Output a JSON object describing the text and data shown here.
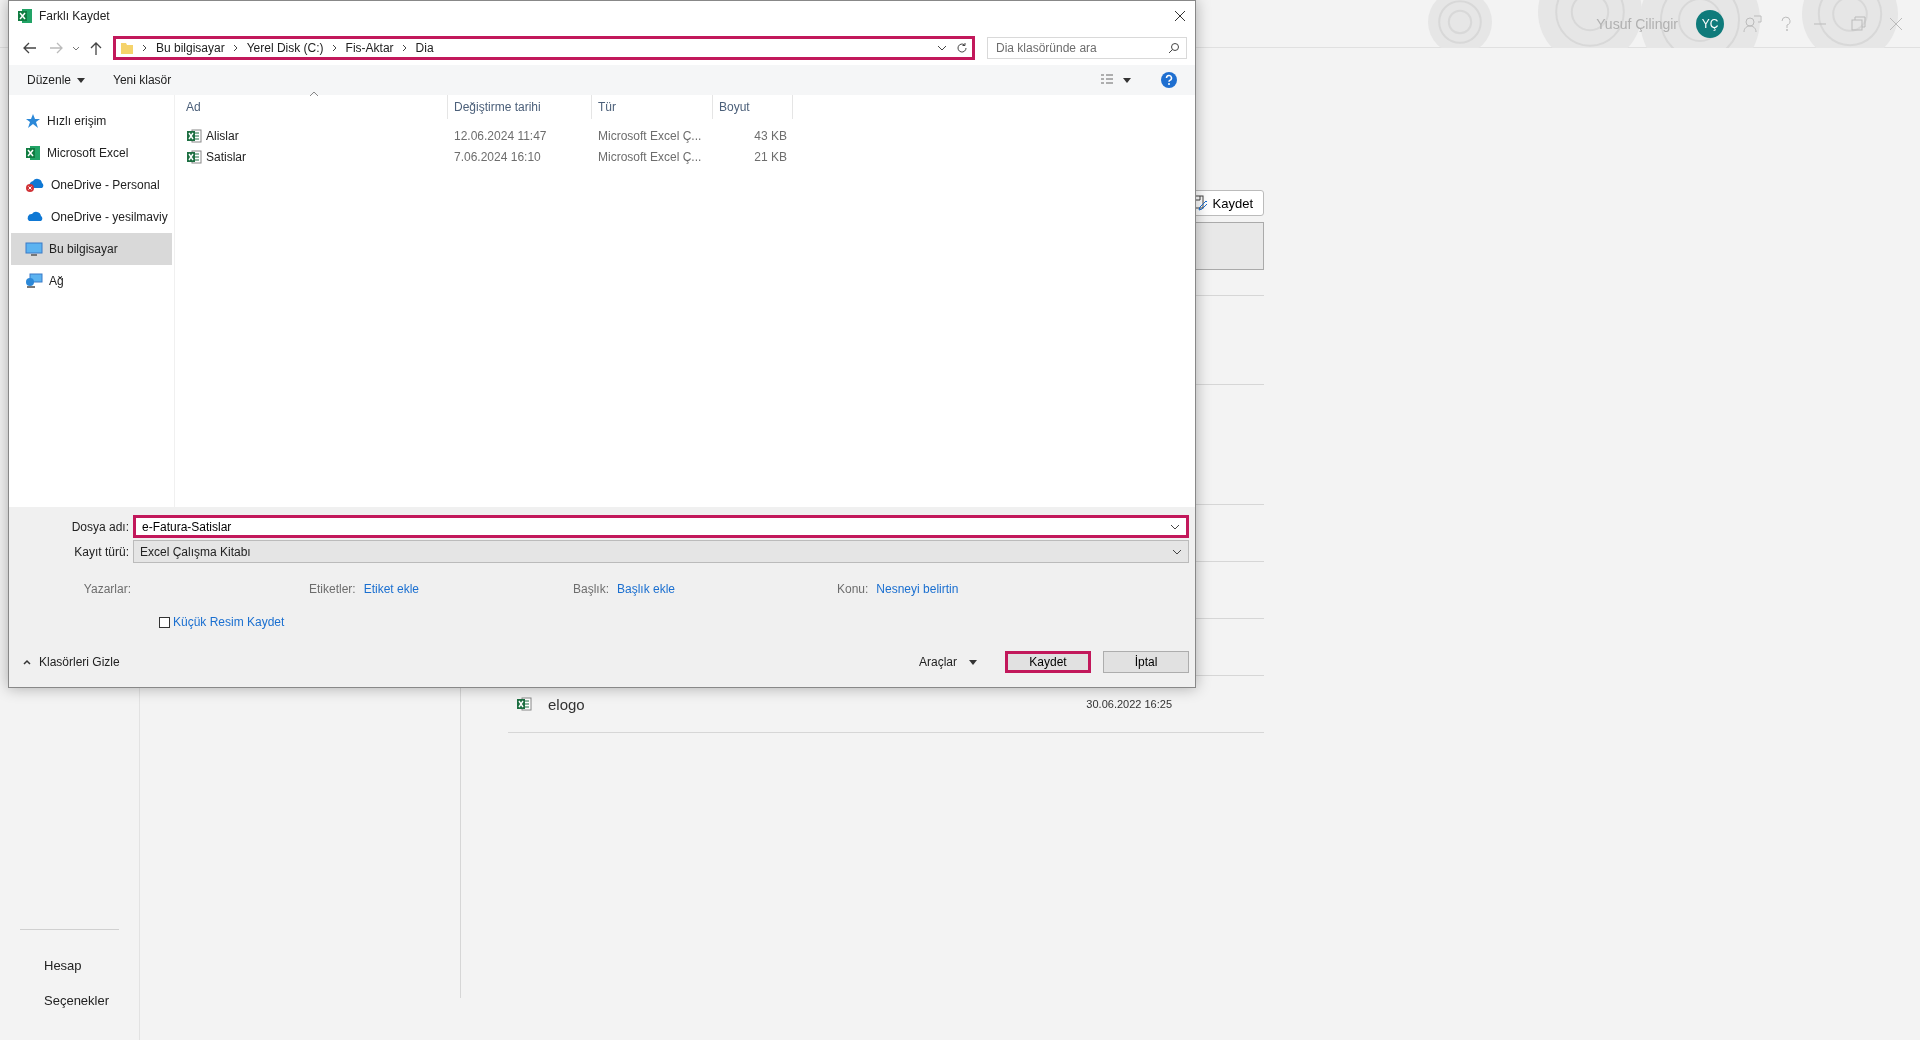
{
  "background": {
    "account_name": "Yusuf Çilingir",
    "avatar_initials": "YÇ",
    "save_button": "Kaydet",
    "files": [
      {
        "name": "elogo",
        "modified": "30.06.2022 16:25"
      }
    ],
    "nav": [
      "Hesap",
      "Seçenekler"
    ]
  },
  "dialog": {
    "title": "Farklı Kaydet",
    "address": {
      "path": [
        "Bu bilgisayar",
        "Yerel Disk (C:)",
        "Fis-Aktar",
        "Dia"
      ],
      "highlighted": true
    },
    "search": {
      "placeholder": "Dia klasöründe ara"
    },
    "toolbar": {
      "organize": "Düzenle",
      "new_folder": "Yeni klasör"
    },
    "sidebar": [
      {
        "label": "Hızlı erişim",
        "kind": "star",
        "selected": false
      },
      {
        "label": "Microsoft Excel",
        "kind": "excel",
        "selected": false
      },
      {
        "label": "OneDrive - Personal",
        "kind": "cloud-error",
        "selected": false
      },
      {
        "label": "OneDrive - yesilmaviy",
        "kind": "cloud",
        "selected": false
      },
      {
        "label": "Bu bilgisayar",
        "kind": "computer",
        "selected": true
      },
      {
        "label": "Ağ",
        "kind": "network",
        "selected": false
      }
    ],
    "columns": [
      {
        "label": "Ad",
        "sorted": true
      },
      {
        "label": "Değiştirme tarihi",
        "sorted": false
      },
      {
        "label": "Tür",
        "sorted": false
      },
      {
        "label": "Boyut",
        "sorted": false
      }
    ],
    "files": [
      {
        "name": "Alislar",
        "modified": "12.06.2024 11:47",
        "type": "Microsoft Excel Ç...",
        "size": "43 KB"
      },
      {
        "name": "Satislar",
        "modified": "7.06.2024 16:10",
        "type": "Microsoft Excel Ç...",
        "size": "21 KB"
      }
    ],
    "file_name": {
      "label": "Dosya adı:",
      "value": "e-Fatura-Satislar",
      "highlighted": true
    },
    "file_type": {
      "label": "Kayıt türü:",
      "value": "Excel Çalışma Kitabı"
    },
    "metadata": [
      {
        "label": "Yazarlar:"
      },
      {
        "label": "Etiketler:",
        "value": "Etiket ekle"
      },
      {
        "label": "Başlık:",
        "value": "Başlık ekle"
      },
      {
        "label": "Konu:",
        "value": "Nesneyi belirtin"
      }
    ],
    "thumbnail": {
      "label": "Küçük Resim Kaydet",
      "checked": false
    },
    "hide_folders": "Klasörleri Gizle",
    "tools": "Araçlar",
    "buttons": [
      {
        "label": "Kaydet",
        "highlighted": true
      },
      {
        "label": "İptal",
        "highlighted": false
      }
    ]
  }
}
